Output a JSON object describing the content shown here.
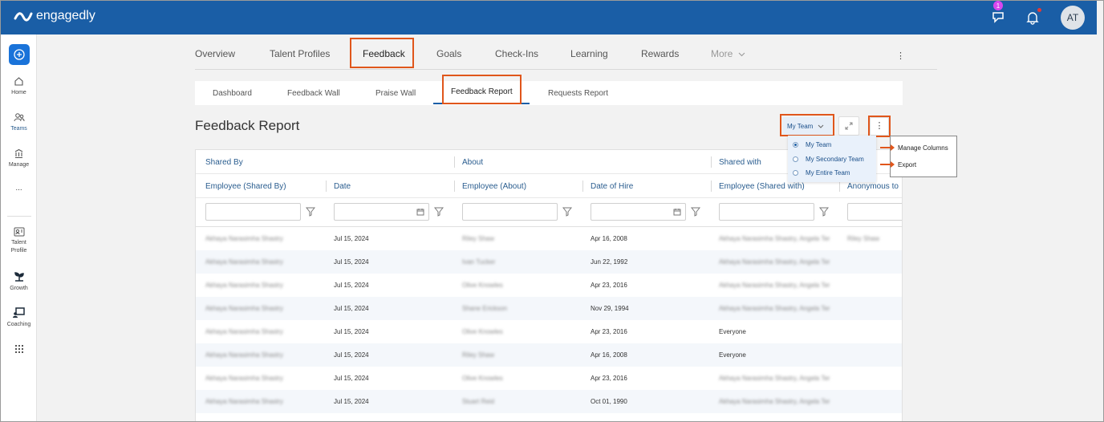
{
  "app": {
    "brand": "engagedly",
    "notification_count": "1",
    "avatar_initials": "AT"
  },
  "sidebar": {
    "items": [
      {
        "label": "Home",
        "icon": "home-icon"
      },
      {
        "label": "Teams",
        "icon": "teams-icon"
      },
      {
        "label": "Manage",
        "icon": "manage-icon"
      },
      {
        "label": "...",
        "icon": "more-icon"
      },
      {
        "label": "Talent Profile",
        "icon": "talent-profile-icon"
      },
      {
        "label": "Growth",
        "icon": "growth-icon"
      },
      {
        "label": "Coaching",
        "icon": "coaching-icon"
      },
      {
        "label": "",
        "icon": "apps-grid-icon"
      }
    ]
  },
  "tabs": [
    {
      "label": "Overview"
    },
    {
      "label": "Talent Profiles"
    },
    {
      "label": "Feedback"
    },
    {
      "label": "Goals"
    },
    {
      "label": "Check-Ins"
    },
    {
      "label": "Learning"
    },
    {
      "label": "Rewards"
    },
    {
      "label": "More"
    }
  ],
  "subtabs": [
    {
      "label": "Dashboard"
    },
    {
      "label": "Feedback Wall"
    },
    {
      "label": "Praise Wall"
    },
    {
      "label": "Feedback Report"
    },
    {
      "label": "Requests Report"
    }
  ],
  "page": {
    "title": "Feedback Report",
    "team_select": "My Team",
    "team_options": [
      "My Team",
      "My Secondary Team",
      "My Entire Team"
    ],
    "more_menu": [
      "Manage Columns",
      "Export"
    ]
  },
  "table": {
    "groups": [
      "Shared By",
      "About",
      "Shared with"
    ],
    "columns": [
      "Employee (Shared By)",
      "Date",
      "Employee (About)",
      "Date of Hire",
      "Employee (Shared with)",
      "Anonymous to"
    ],
    "rows": [
      {
        "shared_by": "Akhaya Narasimha Shastry",
        "date": "Jul 15, 2024",
        "about": "Riley Shaw",
        "hire": "Apr 16, 2008",
        "shared_with": "Akhaya Narasimha Shastry, Angela Ter",
        "anon": "Riley Shaw"
      },
      {
        "shared_by": "Akhaya Narasimha Shastry",
        "date": "Jul 15, 2024",
        "about": "Ivan Tucker",
        "hire": "Jun 22, 1992",
        "shared_with": "Akhaya Narasimha Shastry, Angela Ter",
        "anon": ""
      },
      {
        "shared_by": "Akhaya Narasimha Shastry",
        "date": "Jul 15, 2024",
        "about": "Olive Knowles",
        "hire": "Apr 23, 2016",
        "shared_with": "Akhaya Narasimha Shastry, Angela Ter",
        "anon": ""
      },
      {
        "shared_by": "Akhaya Narasimha Shastry",
        "date": "Jul 15, 2024",
        "about": "Shane Erickson",
        "hire": "Nov 29, 1994",
        "shared_with": "Akhaya Narasimha Shastry, Angela Ter",
        "anon": ""
      },
      {
        "shared_by": "Akhaya Narasimha Shastry",
        "date": "Jul 15, 2024",
        "about": "Olive Knowles",
        "hire": "Apr 23, 2016",
        "shared_with": "Everyone",
        "anon": ""
      },
      {
        "shared_by": "Akhaya Narasimha Shastry",
        "date": "Jul 15, 2024",
        "about": "Riley Shaw",
        "hire": "Apr 16, 2008",
        "shared_with": "Everyone",
        "anon": ""
      },
      {
        "shared_by": "Akhaya Narasimha Shastry",
        "date": "Jul 15, 2024",
        "about": "Olive Knowles",
        "hire": "Apr 23, 2016",
        "shared_with": "Akhaya Narasimha Shastry, Angela Ter",
        "anon": ""
      },
      {
        "shared_by": "Akhaya Narasimha Shastry",
        "date": "Jul 15, 2024",
        "about": "Stuart Reid",
        "hire": "Oct 01, 1990",
        "shared_with": "Akhaya Narasimha Shastry, Angela Ter",
        "anon": ""
      }
    ]
  },
  "colors": {
    "topbar": "#1a5ea6",
    "highlight": "#e0561b",
    "accent": "#1a73d9"
  }
}
